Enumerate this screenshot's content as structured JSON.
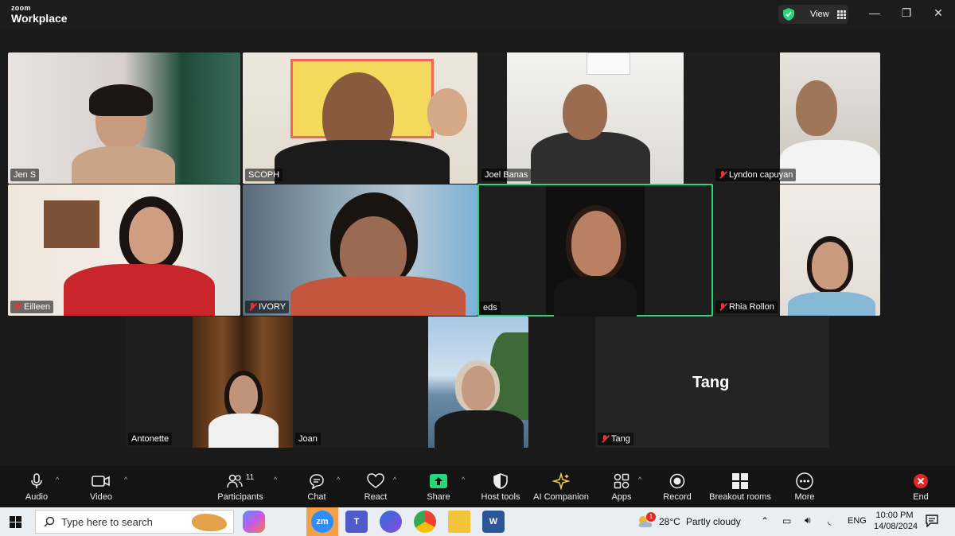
{
  "app": {
    "brand_small": "zoom",
    "brand_big": "Workplace",
    "view_label": "View"
  },
  "window_controls": {
    "minimize": "—",
    "restore": "❐",
    "close": "✕"
  },
  "participants": [
    {
      "name": "Jen S",
      "muted": false
    },
    {
      "name": "SCOPH",
      "muted": false
    },
    {
      "name": "Joel Banas",
      "muted": false
    },
    {
      "name": "Lyndon capuyan",
      "muted": true
    },
    {
      "name": "Eilleen",
      "muted": true
    },
    {
      "name": "IVORY",
      "muted": true
    },
    {
      "name": "eds",
      "muted": false
    },
    {
      "name": "Rhia Rollon",
      "muted": true
    },
    {
      "name": "Antonette",
      "muted": false
    },
    {
      "name": "Joan",
      "muted": false
    },
    {
      "name": "Tang",
      "muted": true
    }
  ],
  "tang_display_name": "Tang",
  "toolbar": {
    "audio": "Audio",
    "video": "Video",
    "participants": "Participants",
    "participants_count": "11",
    "chat": "Chat",
    "react": "React",
    "share": "Share",
    "host_tools": "Host tools",
    "ai_companion": "AI Companion",
    "apps": "Apps",
    "record": "Record",
    "breakout": "Breakout rooms",
    "more": "More",
    "end": "End"
  },
  "taskbar": {
    "search_placeholder": "Type here to search",
    "weather_temp": "28°C",
    "weather_desc": "Partly cloudy",
    "language": "ENG",
    "time": "10:00 PM",
    "date": "14/08/2024",
    "notification_badge": "1",
    "zoom_label": "zm",
    "word_label": "W"
  },
  "colors": {
    "active_speaker": "#2bd47a",
    "share_green": "#2bd47a",
    "end_red": "#e02828",
    "muted_red": "#e33333"
  }
}
